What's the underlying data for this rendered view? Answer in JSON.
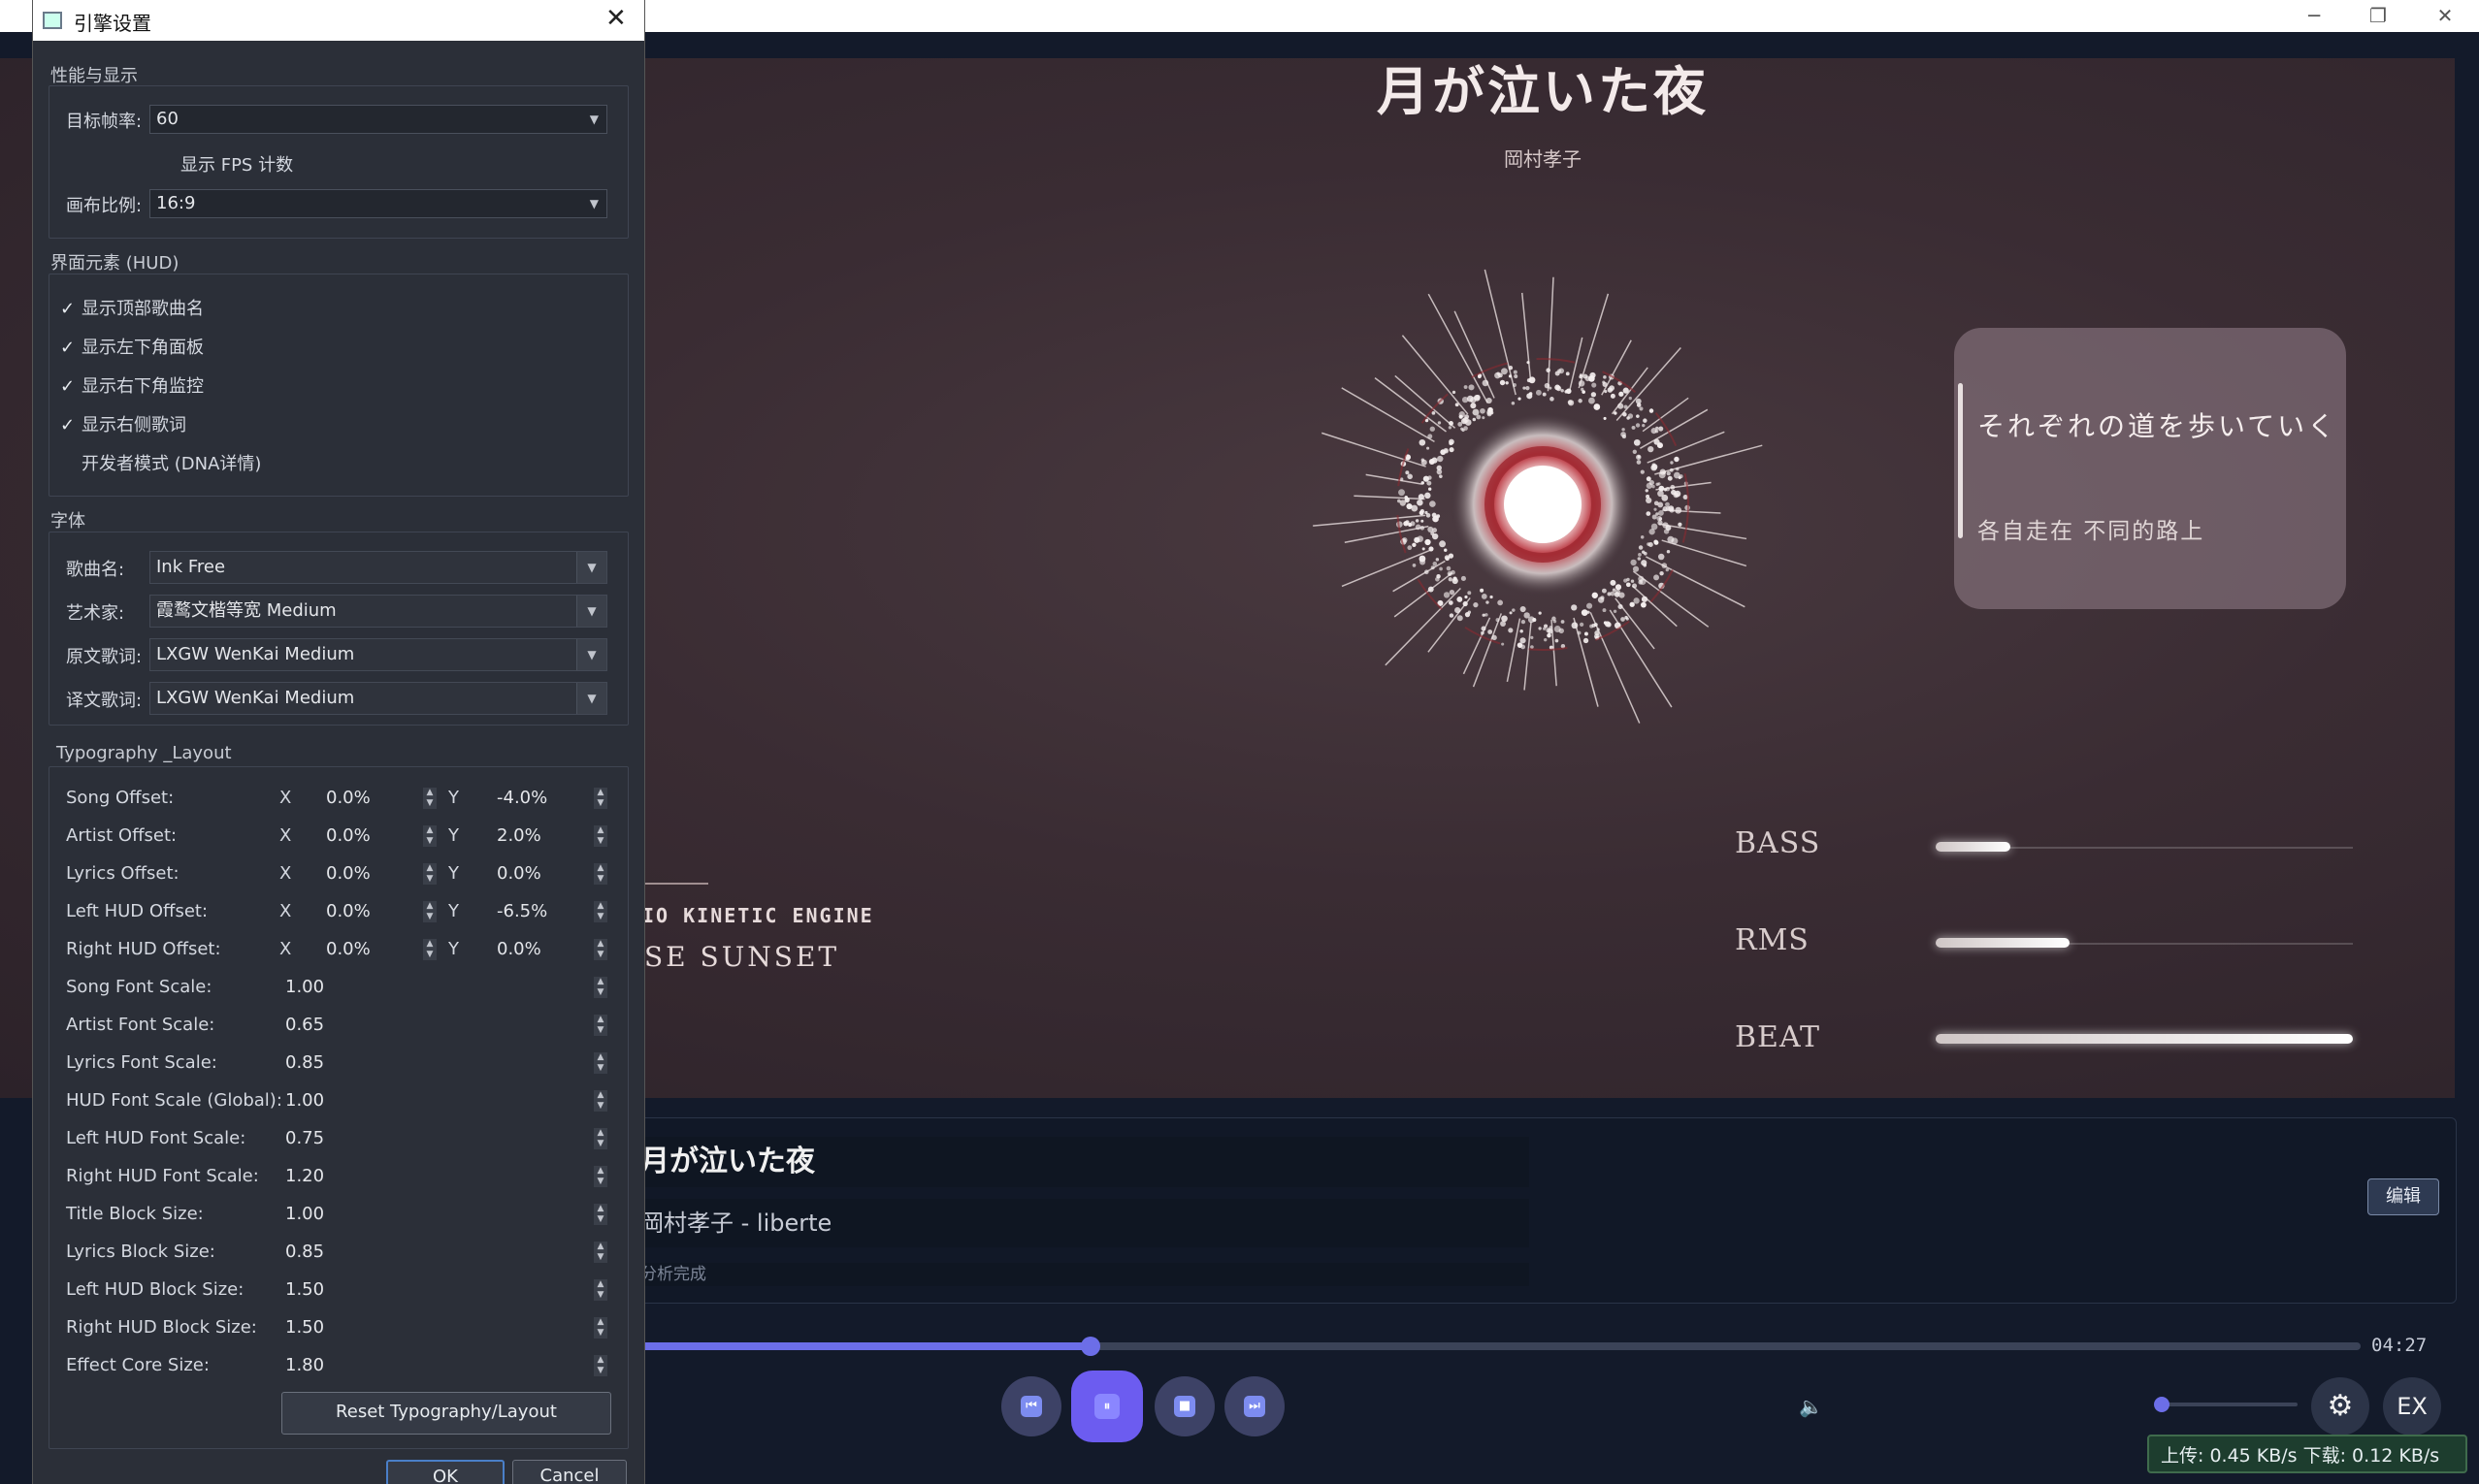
{
  "main": {
    "song_title": "月が泣いた夜",
    "artist": "岡村孝子",
    "lyric_original": "それぞれの道を歩いていく",
    "lyric_translation": "各自走在 不同的路上",
    "hud": [
      {
        "label": "BASS",
        "level": 0.18
      },
      {
        "label": "RMS",
        "level": 0.32
      },
      {
        "label": "BEAT",
        "level": 1.0
      }
    ],
    "engine_label": "IO KINETIC ENGINE",
    "theme_label": "SE SUNSET",
    "info_title": "月が泣いた夜",
    "info_artist": "岡村孝子 - liberte",
    "info_status": "分析完成",
    "edit_label": "编辑",
    "progress": 0.27,
    "time": "04:27",
    "ex_label": "EX",
    "net_status": "上传: 0.45 KB/s    下载: 0.12 KB/s",
    "colors": {
      "accent": "#6c6ee8",
      "core_red": "#b8323c"
    }
  },
  "dialog": {
    "title": "引擎设置",
    "perf": {
      "group_label": "性能与显示",
      "fps_label": "目标帧率:",
      "fps_value": "60",
      "show_fps_label": "显示 FPS 计数",
      "show_fps_checked": false,
      "ratio_label": "画布比例:",
      "ratio_value": "16:9"
    },
    "hud": {
      "group_label": "界面元素 (HUD)",
      "items": [
        {
          "label": "显示顶部歌曲名",
          "checked": true
        },
        {
          "label": "显示左下角面板",
          "checked": true
        },
        {
          "label": "显示右下角监控",
          "checked": true
        },
        {
          "label": "显示右侧歌词",
          "checked": true
        },
        {
          "label": "开发者模式 (DNA详情)",
          "checked": false
        }
      ]
    },
    "fonts": {
      "group_label": "字体",
      "items": [
        {
          "label": "歌曲名:",
          "value": "Ink Free"
        },
        {
          "label": "艺术家:",
          "value": "霞鹜文楷等宽 Medium"
        },
        {
          "label": "原文歌词:",
          "value": "LXGW WenKai Medium"
        },
        {
          "label": "译文歌词:",
          "value": "LXGW WenKai Medium"
        }
      ]
    },
    "typography": {
      "group_label": "Typography _Layout",
      "x_axis": "X",
      "y_axis": "Y",
      "offsets": [
        {
          "label": "Song Offset:",
          "x": "0.0%",
          "y": "-4.0%"
        },
        {
          "label": "Artist Offset:",
          "x": "0.0%",
          "y": "2.0%"
        },
        {
          "label": "Lyrics Offset:",
          "x": "0.0%",
          "y": "0.0%"
        },
        {
          "label": "Left HUD Offset:",
          "x": "0.0%",
          "y": "-6.5%"
        },
        {
          "label": "Right HUD Offset:",
          "x": "0.0%",
          "y": "0.0%"
        }
      ],
      "scales": [
        {
          "label": "Song Font Scale:",
          "value": "1.00"
        },
        {
          "label": "Artist Font Scale:",
          "value": "0.65"
        },
        {
          "label": "Lyrics Font Scale:",
          "value": "0.85"
        },
        {
          "label": "HUD Font Scale (Global):",
          "value": "1.00"
        },
        {
          "label": "Left HUD Font Scale:",
          "value": "0.75"
        },
        {
          "label": "Right HUD Font Scale:",
          "value": "1.20"
        },
        {
          "label": "Title Block Size:",
          "value": "1.00"
        },
        {
          "label": "Lyrics Block Size:",
          "value": "0.85"
        },
        {
          "label": "Left HUD Block Size:",
          "value": "1.50"
        },
        {
          "label": "Right HUD Block Size:",
          "value": "1.50"
        },
        {
          "label": "Effect Core Size:",
          "value": "1.80"
        }
      ],
      "reset_label": "Reset Typography/Layout"
    },
    "ok_label": "OK",
    "cancel_label": "Cancel"
  }
}
